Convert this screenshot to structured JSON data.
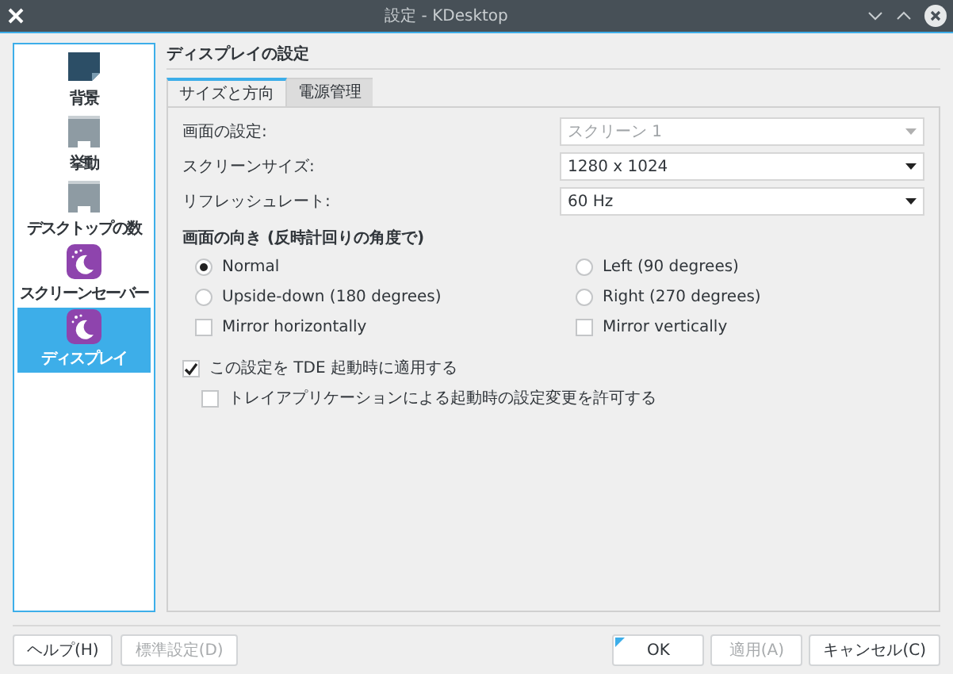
{
  "window": {
    "title": "設定 - KDesktop"
  },
  "sidebar": {
    "items": [
      {
        "label": "背景",
        "kind": "wallpaper",
        "selected": false
      },
      {
        "label": "挙動",
        "kind": "monitor",
        "selected": false
      },
      {
        "label": "デスクトップの数",
        "kind": "monitor",
        "selected": false
      },
      {
        "label": "スクリーンセーバー",
        "kind": "moon",
        "selected": false
      },
      {
        "label": "ディスプレイ",
        "kind": "moon",
        "selected": true
      }
    ]
  },
  "heading": "ディスプレイの設定",
  "tabs": [
    {
      "label": "サイズと方向",
      "selected": true
    },
    {
      "label": "電源管理",
      "selected": false
    }
  ],
  "fields": [
    {
      "label": "画面の設定:",
      "value": "スクリーン 1",
      "disabled": true
    },
    {
      "label": "スクリーンサイズ:",
      "value": "1280 x 1024",
      "disabled": false
    },
    {
      "label": "リフレッシュレート:",
      "value": "60 Hz",
      "disabled": false
    }
  ],
  "orientation": {
    "title": "画面の向き (反時計回りの角度で)",
    "options": [
      {
        "kind": "radio",
        "label": "Normal",
        "selected": true
      },
      {
        "kind": "radio",
        "label": "Left (90 degrees)",
        "selected": false
      },
      {
        "kind": "radio",
        "label": "Upside-down (180 degrees)",
        "selected": false
      },
      {
        "kind": "radio",
        "label": "Right (270 degrees)",
        "selected": false
      },
      {
        "kind": "checkbox",
        "label": "Mirror horizontally",
        "checked": false
      },
      {
        "kind": "checkbox",
        "label": "Mirror vertically",
        "checked": false
      }
    ]
  },
  "apply_on_startup": {
    "label": "この設定を TDE 起動時に適用する",
    "checked": true
  },
  "allow_tray": {
    "label": "トレイアプリケーションによる起動時の設定変更を許可する",
    "checked": false
  },
  "buttons_left": [
    {
      "label": "ヘルプ(H)",
      "disabled": false,
      "default": false
    },
    {
      "label": "標準設定(D)",
      "disabled": true,
      "default": false
    }
  ],
  "buttons_right": [
    {
      "label": "OK",
      "disabled": false,
      "default": true
    },
    {
      "label": "適用(A)",
      "disabled": true,
      "default": false
    },
    {
      "label": "キャンセル(C)",
      "disabled": false,
      "default": false
    }
  ]
}
